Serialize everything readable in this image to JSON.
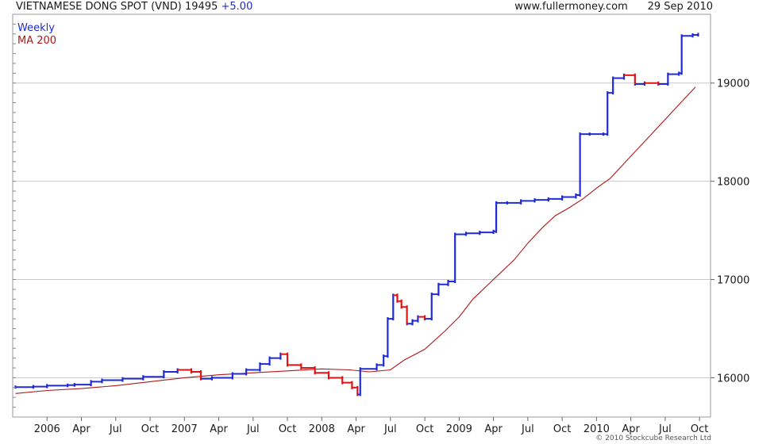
{
  "header": {
    "symbol_title": "VIETNAMESE DONG SPOT (VND)",
    "last_value": "19495",
    "change": "+5.00",
    "source": "www.fullermoney.com",
    "date": "29 Sep 2010"
  },
  "legend": [
    {
      "label": "Weekly",
      "color": "#1f2bd6"
    },
    {
      "label": "MA 200",
      "color": "#b01818"
    }
  ],
  "copyright": "© 2010 Stockcube Research Ltd",
  "colors": {
    "up": "#1f2bd6",
    "down": "#e01414",
    "ma": "#b01818",
    "grid": "#c8c8c8"
  },
  "chart_data": {
    "type": "line",
    "ylim": [
      15600,
      19700
    ],
    "y_ticks": [
      16000,
      17000,
      18000,
      19000
    ],
    "y_tick_labels": [
      "16000",
      "17000",
      "18000",
      "19000"
    ],
    "x_range": [
      2005.75,
      2010.83
    ],
    "x_ticks": [
      {
        "t": 2006.0,
        "label": "2006"
      },
      {
        "t": 2006.25,
        "label": "Apr"
      },
      {
        "t": 2006.5,
        "label": "Jul"
      },
      {
        "t": 2006.75,
        "label": "Oct"
      },
      {
        "t": 2007.0,
        "label": "2007"
      },
      {
        "t": 2007.25,
        "label": "Apr"
      },
      {
        "t": 2007.5,
        "label": "Jul"
      },
      {
        "t": 2007.75,
        "label": "Oct"
      },
      {
        "t": 2008.0,
        "label": "2008"
      },
      {
        "t": 2008.25,
        "label": "Apr"
      },
      {
        "t": 2008.5,
        "label": "Jul"
      },
      {
        "t": 2008.75,
        "label": "Oct"
      },
      {
        "t": 2009.0,
        "label": "2009"
      },
      {
        "t": 2009.25,
        "label": "Apr"
      },
      {
        "t": 2009.5,
        "label": "Jul"
      },
      {
        "t": 2009.75,
        "label": "Oct"
      },
      {
        "t": 2010.0,
        "label": "2010"
      },
      {
        "t": 2010.25,
        "label": "Apr"
      },
      {
        "t": 2010.5,
        "label": "Jul"
      },
      {
        "t": 2010.75,
        "label": "Oct"
      }
    ],
    "series": [
      {
        "name": "Weekly",
        "points": [
          [
            2005.77,
            15905
          ],
          [
            2005.9,
            15910
          ],
          [
            2006.0,
            15920
          ],
          [
            2006.15,
            15925
          ],
          [
            2006.2,
            15930
          ],
          [
            2006.32,
            15960
          ],
          [
            2006.4,
            15975
          ],
          [
            2006.55,
            15990
          ],
          [
            2006.7,
            16010
          ],
          [
            2006.85,
            16060
          ],
          [
            2006.95,
            16080
          ],
          [
            2007.05,
            16060
          ],
          [
            2007.12,
            15990
          ],
          [
            2007.2,
            16000
          ],
          [
            2007.35,
            16040
          ],
          [
            2007.45,
            16080
          ],
          [
            2007.55,
            16140
          ],
          [
            2007.62,
            16200
          ],
          [
            2007.7,
            16240
          ],
          [
            2007.75,
            16130
          ],
          [
            2007.85,
            16100
          ],
          [
            2007.95,
            16050
          ],
          [
            2008.05,
            16000
          ],
          [
            2008.15,
            15950
          ],
          [
            2008.22,
            15900
          ],
          [
            2008.26,
            15830
          ],
          [
            2008.28,
            16090
          ],
          [
            2008.4,
            16130
          ],
          [
            2008.45,
            16220
          ],
          [
            2008.48,
            16600
          ],
          [
            2008.52,
            16840
          ],
          [
            2008.55,
            16780
          ],
          [
            2008.58,
            16720
          ],
          [
            2008.62,
            16550
          ],
          [
            2008.66,
            16580
          ],
          [
            2008.7,
            16620
          ],
          [
            2008.75,
            16600
          ],
          [
            2008.8,
            16850
          ],
          [
            2008.85,
            16950
          ],
          [
            2008.92,
            16980
          ],
          [
            2008.97,
            17460
          ],
          [
            2009.05,
            17470
          ],
          [
            2009.15,
            17480
          ],
          [
            2009.25,
            17490
          ],
          [
            2009.27,
            17780
          ],
          [
            2009.35,
            17780
          ],
          [
            2009.45,
            17800
          ],
          [
            2009.55,
            17810
          ],
          [
            2009.65,
            17820
          ],
          [
            2009.75,
            17840
          ],
          [
            2009.85,
            17860
          ],
          [
            2009.88,
            18480
          ],
          [
            2009.95,
            18480
          ],
          [
            2010.05,
            18480
          ],
          [
            2010.08,
            18900
          ],
          [
            2010.12,
            19050
          ],
          [
            2010.2,
            19080
          ],
          [
            2010.28,
            18990
          ],
          [
            2010.35,
            19000
          ],
          [
            2010.45,
            18990
          ],
          [
            2010.52,
            19090
          ],
          [
            2010.6,
            19100
          ],
          [
            2010.62,
            19480
          ],
          [
            2010.7,
            19490
          ],
          [
            2010.74,
            19495
          ]
        ]
      },
      {
        "name": "MA 200",
        "points": [
          [
            2005.77,
            15840
          ],
          [
            2006.0,
            15870
          ],
          [
            2006.25,
            15890
          ],
          [
            2006.5,
            15920
          ],
          [
            2006.75,
            15960
          ],
          [
            2007.0,
            16000
          ],
          [
            2007.25,
            16030
          ],
          [
            2007.5,
            16050
          ],
          [
            2007.75,
            16070
          ],
          [
            2008.0,
            16090
          ],
          [
            2008.2,
            16080
          ],
          [
            2008.35,
            16060
          ],
          [
            2008.5,
            16080
          ],
          [
            2008.6,
            16180
          ],
          [
            2008.75,
            16290
          ],
          [
            2008.9,
            16480
          ],
          [
            2009.0,
            16620
          ],
          [
            2009.1,
            16800
          ],
          [
            2009.25,
            17000
          ],
          [
            2009.4,
            17200
          ],
          [
            2009.5,
            17370
          ],
          [
            2009.6,
            17520
          ],
          [
            2009.7,
            17650
          ],
          [
            2009.8,
            17730
          ],
          [
            2009.9,
            17820
          ],
          [
            2010.0,
            17930
          ],
          [
            2010.1,
            18030
          ],
          [
            2010.2,
            18180
          ],
          [
            2010.3,
            18330
          ],
          [
            2010.4,
            18480
          ],
          [
            2010.5,
            18630
          ],
          [
            2010.6,
            18780
          ],
          [
            2010.72,
            18960
          ]
        ]
      }
    ]
  }
}
